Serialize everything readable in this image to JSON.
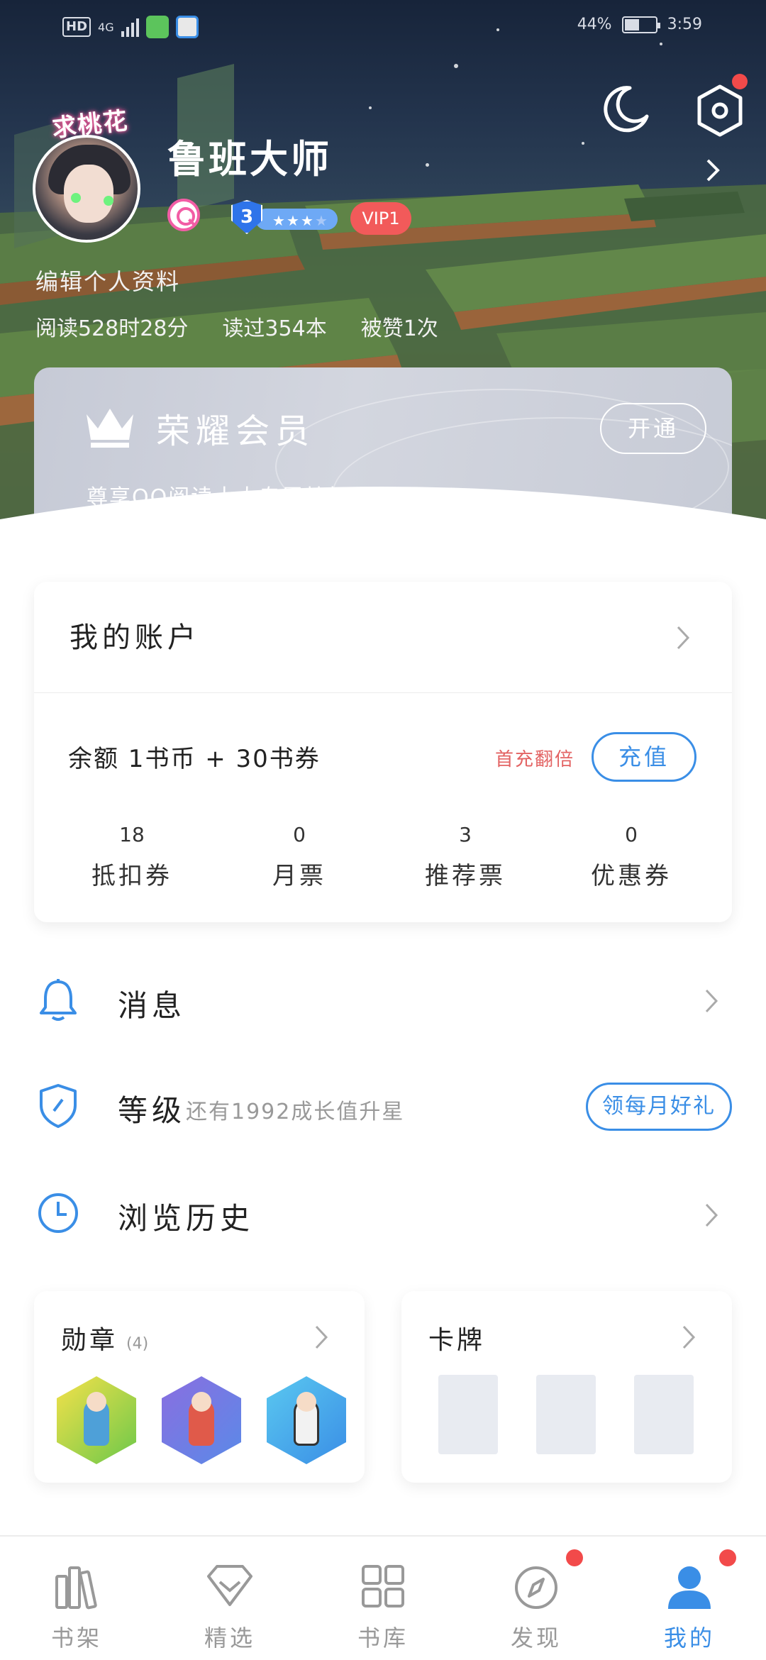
{
  "status_bar": {
    "hd": "HD",
    "network": "4G",
    "battery": "44%",
    "time": "3:59"
  },
  "header": {
    "badge_text": "求桃花",
    "username": "鲁班大师",
    "level": "3",
    "vip": "VIP1",
    "edit_profile": "编辑个人资料",
    "stats": [
      "阅读528时28分",
      "读过354本",
      "被赞1次"
    ]
  },
  "member_card": {
    "title": "荣耀会员",
    "subtitle": "尊享QQ阅读十大专属特权",
    "open_label": "开通"
  },
  "account": {
    "title": "我的账户",
    "balance": "余额  1书币 + 30书券",
    "promo": "首充翻倍",
    "recharge_label": "充值",
    "stats": [
      {
        "value": "18",
        "label": "抵扣券"
      },
      {
        "value": "0",
        "label": "月票"
      },
      {
        "value": "3",
        "label": "推荐票"
      },
      {
        "value": "0",
        "label": "优惠券"
      }
    ]
  },
  "menu": {
    "messages": "消息",
    "level": "等级",
    "level_sub": "还有1992成长值升星",
    "monthly_gift": "领每月好礼",
    "history": "浏览历史"
  },
  "medals": {
    "title": "勋章",
    "count": "(4)"
  },
  "cards": {
    "title": "卡牌"
  },
  "tabs": [
    {
      "label": "书架",
      "icon": "bookshelf-icon"
    },
    {
      "label": "精选",
      "icon": "diamond-icon"
    },
    {
      "label": "书库",
      "icon": "grid-icon"
    },
    {
      "label": "发现",
      "icon": "compass-icon"
    },
    {
      "label": "我的",
      "icon": "person-icon",
      "active": true
    }
  ],
  "colors": {
    "accent": "#3a8ee6",
    "vip_red": "#f25a5a",
    "promo_red": "#e36363",
    "notify_dot": "#f24a4a"
  }
}
